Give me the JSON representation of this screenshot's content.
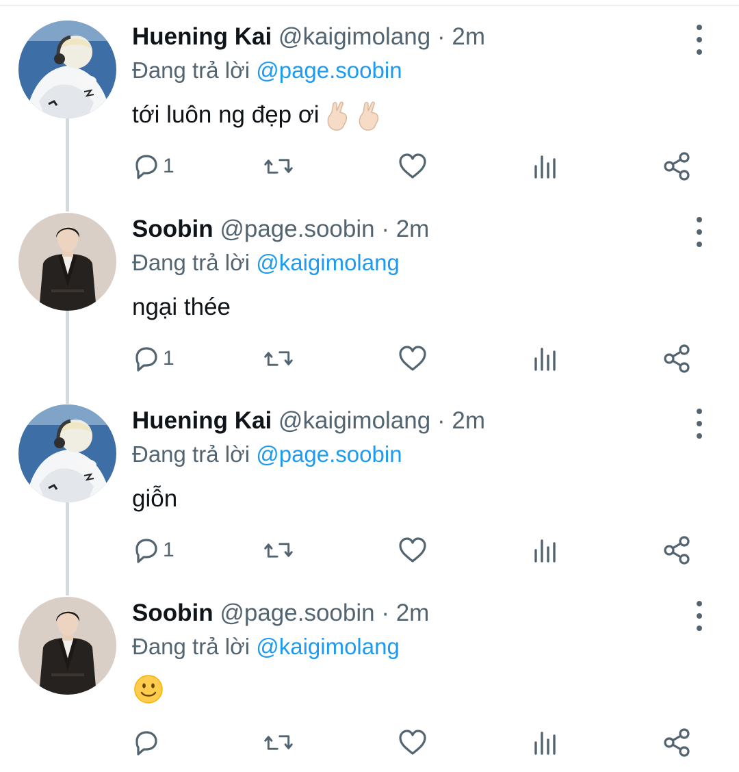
{
  "colors": {
    "text": "#0f1419",
    "secondary": "#536471",
    "accent": "#1d9bf0",
    "thread_line": "#d5dade"
  },
  "reply_prefix": "Đang trả lời",
  "tweets": [
    {
      "name": "Huening Kai",
      "handle": "@kaigimolang",
      "dot": "·",
      "time": "2m",
      "reply_to": "@page.soobin",
      "text": "tới luôn ng đẹp ơi",
      "emoji": [
        "crossed-fingers-emoji",
        "crossed-fingers-emoji"
      ],
      "reply_count": "1",
      "avatar": "white-hoodie-headphones-avatar"
    },
    {
      "name": "Soobin",
      "handle": "@page.soobin",
      "dot": "·",
      "time": "2m",
      "reply_to": "@kaigimolang",
      "text": "ngại thée",
      "emoji": [],
      "reply_count": "1",
      "avatar": "black-suit-avatar"
    },
    {
      "name": "Huening Kai",
      "handle": "@kaigimolang",
      "dot": "·",
      "time": "2m",
      "reply_to": "@page.soobin",
      "text": "giỗn",
      "emoji": [],
      "reply_count": "1",
      "avatar": "white-hoodie-headphones-avatar"
    },
    {
      "name": "Soobin",
      "handle": "@page.soobin",
      "dot": "·",
      "time": "2m",
      "reply_to": "@kaigimolang",
      "text": "",
      "emoji": [
        "slightly-smiling-face-emoji"
      ],
      "reply_count": "",
      "avatar": "black-suit-avatar"
    }
  ],
  "action_icons": [
    "reply-icon",
    "retweet-icon",
    "like-icon",
    "analytics-icon",
    "share-icon"
  ]
}
